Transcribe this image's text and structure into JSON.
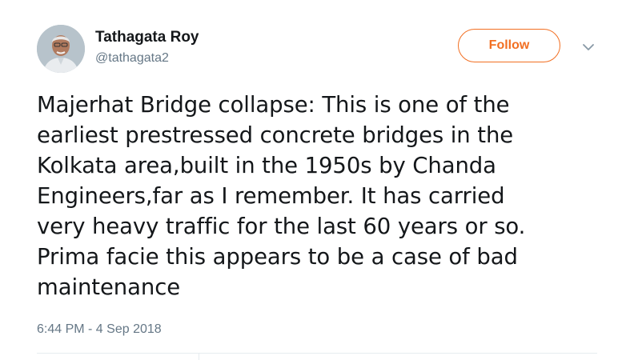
{
  "user": {
    "name": "Tathagata Roy",
    "handle": "@tathagata2",
    "avatar_icon": "profile-photo"
  },
  "actions": {
    "follow_label": "Follow",
    "menu_icon": "chevron-down-icon"
  },
  "tweet": {
    "text": "Majerhat Bridge collapse: This is one of the\nearliest prestressed concrete bridges in the\nKolkata area,built in the 1950s by Chanda\nEngineers,far as I remember. It has carried\nvery heavy traffic for the last 60 years or so.\nPrima facie this appears to be a case of bad\nmaintenance",
    "timestamp": "6:44 PM - 4 Sep 2018"
  },
  "colors": {
    "accent": "#f26f22",
    "text": "#14171a",
    "secondary_text": "#657786",
    "divider": "#e6ecf0"
  }
}
